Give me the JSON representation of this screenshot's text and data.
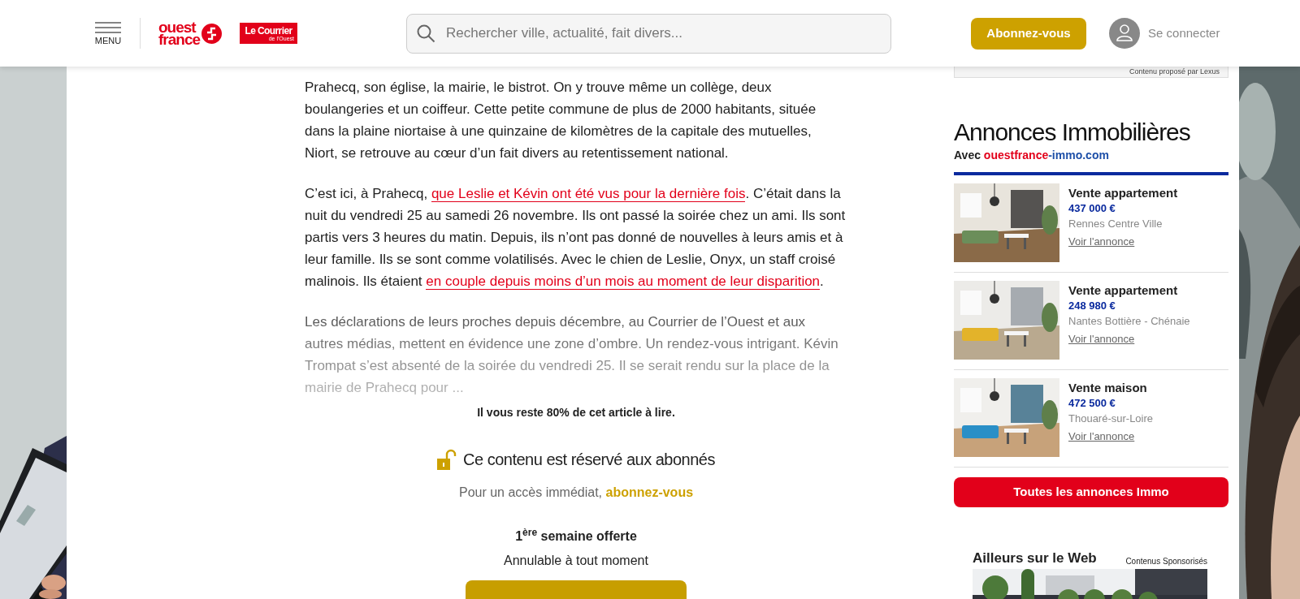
{
  "header": {
    "menu_label": "MENU",
    "logo": {
      "lines": [
        "ouest",
        "france"
      ]
    },
    "partner_logo": {
      "title": "Le Courrier",
      "subtitle": "de l'Ouest"
    },
    "search": {
      "placeholder": "Rechercher ville, actualité, fait divers..."
    },
    "subscribe_button": "Abonnez-vous",
    "login": "Se connecter"
  },
  "article": {
    "paragraphs": [
      {
        "faded": false,
        "segments": [
          {
            "text": "Prahecq, son église, la mairie, le bistrot. On y trouve même un collège, deux boulangeries et un coiffeur. Cette petite commune de plus de 2000 habitants, située dans la plaine niortaise à une quinzaine de kilomètres de la capitale des mutuelles, Niort, se retrouve au cœur d’un fait divers au retentissement national.",
            "link": false
          }
        ]
      },
      {
        "faded": false,
        "segments": [
          {
            "text": "C’est ici, à Prahecq, ",
            "link": false
          },
          {
            "text": "que Leslie et Kévin ont été vus pour la dernière fois",
            "link": true
          },
          {
            "text": ". C’était dans la nuit du vendredi 25 au samedi 26 novembre. Ils ont passé la soirée chez un ami. Ils sont partis vers 3 heures du matin. Depuis, ils n’ont pas donné de nouvelles à leurs amis et à leur famille. Ils se sont comme volatilisés. Avec le chien de Leslie, Onyx, un staff croisé malinois. Ils étaient ",
            "link": false
          },
          {
            "text": "en couple depuis moins d’un mois au moment de leur disparition",
            "link": true
          },
          {
            "text": ".",
            "link": false
          }
        ]
      },
      {
        "faded": true,
        "segments": [
          {
            "text": "Les déclarations de leurs proches depuis décembre, au Courrier de l’Ouest et aux autres médias, mettent en évidence une zone d’ombre. Un rendez-vous intrigant. Kévin Trompat s’est absenté de la soirée du vendredi 25. Il se serait rendu sur la place de la mairie de Prahecq pour ...",
            "link": false
          }
        ]
      }
    ]
  },
  "paywall": {
    "remaining": "Il vous reste 80% de cet article à lire.",
    "title": "Ce contenu est réservé aux abonnés",
    "access_text": "Pour un accès immédiat,",
    "access_link": "abonnez-vous",
    "offer": "1$^{ère}$ semaine offerte",
    "cancel": "Annulable à tout moment"
  },
  "sidebar": {
    "sponsor_note": "Contenu proposé par Lexus",
    "title": "Annonces Immobilières",
    "source": {
      "prefix": "Avec",
      "parts": [
        {
          "text": "ouestfrance",
          "color": "#e2001a"
        },
        {
          "text": "-immo.com",
          "color": "#1d4fa8"
        }
      ]
    },
    "listings": [
      {
        "title": "Vente appartement",
        "price": "437 000 €",
        "location": "Rennes Centre Ville",
        "link": "Voir l'annonce"
      },
      {
        "title": "Vente appartement",
        "price": "248 980 €",
        "location": "Nantes Bottière - Chénaie",
        "link": "Voir l'annonce"
      },
      {
        "title": "Vente maison",
        "price": "472 500 €",
        "location": "Thouaré-sur-Loire",
        "link": "Voir l'annonce"
      }
    ],
    "all_button": "Toutes les annonces Immo",
    "web": {
      "title": "Ailleurs sur le Web",
      "note": "Contenus Sponsorisés"
    }
  }
}
